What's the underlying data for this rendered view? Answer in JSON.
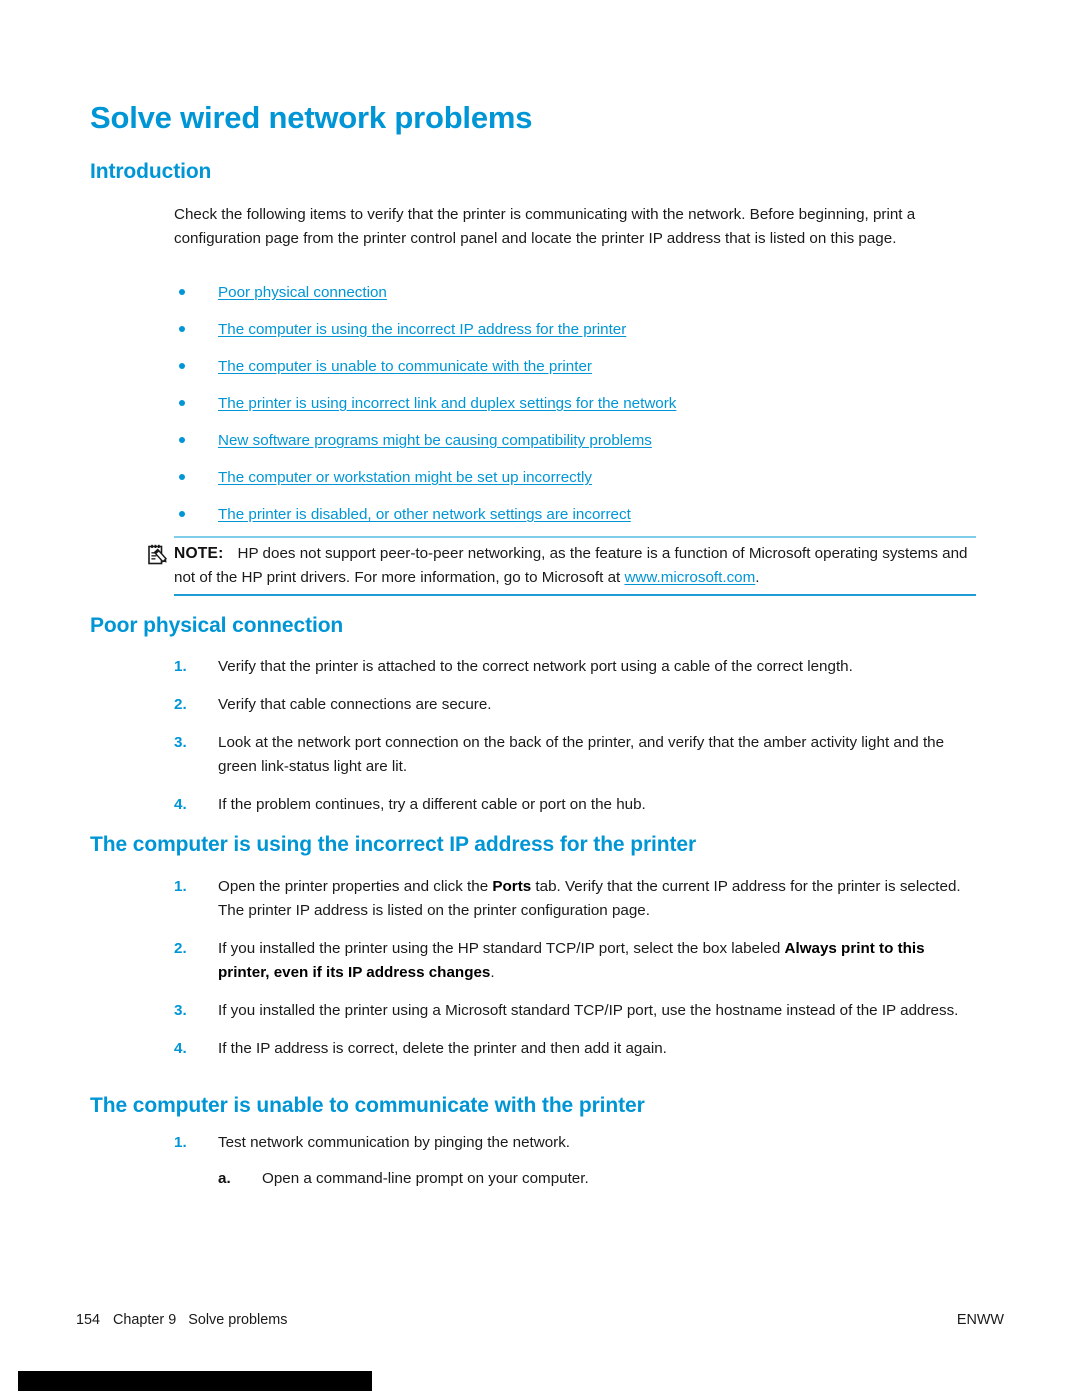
{
  "page": {
    "title": "Solve wired network problems"
  },
  "sections": {
    "introduction": {
      "heading": "Introduction",
      "paragraph": "Check the following items to verify that the printer is communicating with the network. Before beginning, print a configuration page from the printer control panel and locate the printer IP address that is listed on this page.",
      "links": [
        "Poor physical connection",
        "The computer is using the incorrect IP address for the printer",
        "The computer is unable to communicate with the printer",
        "The printer is using incorrect link and duplex settings for the network",
        "New software programs might be causing compatibility problems",
        "The computer or workstation might be set up incorrectly",
        "The printer is disabled, or other network settings are incorrect"
      ]
    },
    "note": {
      "icon": "note-pencil-icon",
      "label": "NOTE:",
      "text_before_link": "HP does not support peer-to-peer networking, as the feature is a function of Microsoft operating systems and not of the HP print drivers. For more information, go to Microsoft at ",
      "link": "www.microsoft.com",
      "text_after_link": "."
    },
    "poor_physical_connection": {
      "heading": "Poor physical connection",
      "items": [
        {
          "marker": "1.",
          "text": "Verify that the printer is attached to the correct network port using a cable of the correct length."
        },
        {
          "marker": "2.",
          "text": "Verify that cable connections are secure."
        },
        {
          "marker": "3.",
          "text": "Look at the network port connection on the back of the printer, and verify that the amber activity light and the green link-status light are lit."
        },
        {
          "marker": "4.",
          "text": "If the problem continues, try a different cable or port on the hub."
        }
      ]
    },
    "incorrect_ip": {
      "heading": "The computer is using the incorrect IP address for the printer",
      "items": [
        {
          "marker": "1.",
          "part1": "Open the printer properties and click the ",
          "bold1": "Ports",
          "part2": " tab. Verify that the current IP address for the printer is selected. The printer IP address is listed on the printer configuration page.",
          "bold2": "",
          "part3": ""
        },
        {
          "marker": "2.",
          "part1": "If you installed the printer using the HP standard TCP/IP port, select the box labeled ",
          "bold1": "Always print to this printer, even if its IP address changes",
          "part2": ".",
          "bold2": "",
          "part3": ""
        },
        {
          "marker": "3.",
          "part1": "If you installed the printer using a Microsoft standard TCP/IP port, use the hostname instead of the IP address.",
          "bold1": "",
          "part2": "",
          "bold2": "",
          "part3": ""
        },
        {
          "marker": "4.",
          "part1": "If the IP address is correct, delete the printer and then add it again.",
          "bold1": "",
          "part2": "",
          "bold2": "",
          "part3": ""
        }
      ]
    },
    "unable_to_communicate": {
      "heading": "The computer is unable to communicate with the printer",
      "items": [
        {
          "marker": "1.",
          "text": "Test network communication by pinging the network."
        }
      ],
      "sub_items": [
        {
          "marker": "a.",
          "text": "Open a command-line prompt on your computer."
        }
      ]
    }
  },
  "footer": {
    "page_number": "154",
    "chapter": "Chapter 9",
    "chapter_title": "Solve problems",
    "locale": "ENWW"
  },
  "colors": {
    "accent_blue": "#0096d6",
    "rule_light": "#7fcde8",
    "rule_dark": "#1f9bd6",
    "text": "#1a1a1a"
  }
}
